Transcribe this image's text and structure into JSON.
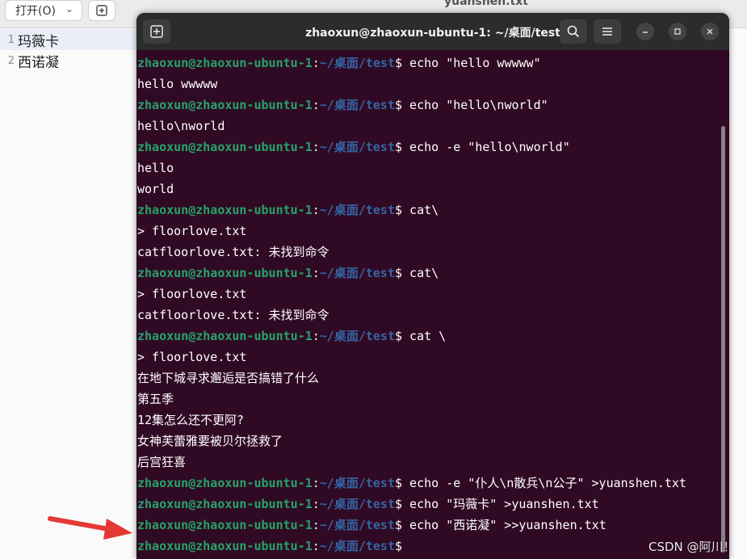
{
  "editor": {
    "open_label": "打开(O)",
    "file_title": "yuanshen.txt",
    "lines": [
      {
        "num": "1",
        "text": "玛薇卡"
      },
      {
        "num": "2",
        "text": "西诺凝"
      }
    ]
  },
  "terminal": {
    "title": "zhaoxun@zhaoxun-ubuntu-1: ~/桌面/test",
    "prompt_user": "zhaoxun@zhaoxun-ubuntu-1",
    "prompt_sep": ":",
    "prompt_path": "~/桌面/test",
    "prompt_dollar": "$",
    "lines": [
      {
        "type": "prompt",
        "cmd": " echo \"hello wwwww\""
      },
      {
        "type": "out",
        "text": "hello wwwww"
      },
      {
        "type": "prompt",
        "cmd": " echo \"hello\\nworld\""
      },
      {
        "type": "out",
        "text": "hello\\nworld"
      },
      {
        "type": "prompt",
        "cmd": " echo -e \"hello\\nworld\""
      },
      {
        "type": "out",
        "text": "hello"
      },
      {
        "type": "out",
        "text": "world"
      },
      {
        "type": "prompt",
        "cmd": " cat\\"
      },
      {
        "type": "out",
        "text": "> floorlove.txt"
      },
      {
        "type": "out",
        "text": "catfloorlove.txt: 未找到命令"
      },
      {
        "type": "prompt",
        "cmd": " cat\\"
      },
      {
        "type": "out",
        "text": "> floorlove.txt"
      },
      {
        "type": "out",
        "text": "catfloorlove.txt: 未找到命令"
      },
      {
        "type": "prompt",
        "cmd": " cat \\"
      },
      {
        "type": "out",
        "text": "> floorlove.txt"
      },
      {
        "type": "out",
        "text": "在地下城寻求邂逅是否搞错了什么"
      },
      {
        "type": "out",
        "text": "第五季"
      },
      {
        "type": "out",
        "text": "12集怎么还不更阿?"
      },
      {
        "type": "out",
        "text": "女神芙蕾雅要被贝尔拯救了"
      },
      {
        "type": "out",
        "text": "后宫狂喜"
      },
      {
        "type": "prompt",
        "cmd": " echo -e \"仆人\\n散兵\\n公子\" >yuanshen.txt"
      },
      {
        "type": "prompt",
        "cmd": " echo \"玛薇卡\" >yuanshen.txt"
      },
      {
        "type": "prompt",
        "cmd": " echo \"西诺凝\" >>yuanshen.txt"
      },
      {
        "type": "prompt",
        "cmd": ""
      }
    ]
  },
  "watermark": "CSDN @阿川！",
  "colors": {
    "terminal_bg": "#300a24",
    "prompt_user": "#26a269",
    "prompt_path": "#3465a4",
    "arrow": "#e53935"
  }
}
